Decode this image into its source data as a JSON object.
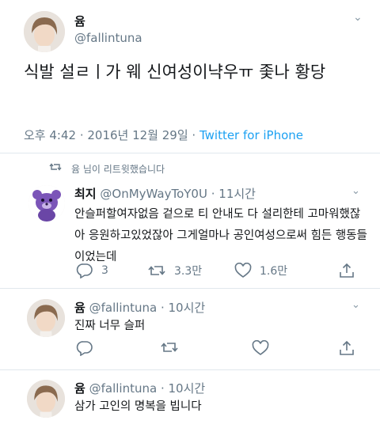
{
  "main_tweet": {
    "display_name": "윰",
    "handle": "@fallintuna",
    "text": "식발 설ㄹㅣ가 웨 신여성이냑우ㅠ 좇나 황당",
    "timestamp": "오후 4:42 · 2016년 12월 29일 · ",
    "source": "Twitter for iPhone"
  },
  "retweet_note": "윰 님이 리트윗했습니다",
  "retweeted": {
    "display_name": "최지",
    "handle": "@OnMyWayToY0U",
    "time": "· 11시간",
    "text": "안슬퍼할여자없음 겉으로 티 안내도 다 설리한테 고마워했잖아 응원하고있었잖아 그게얼마나 공인여성으로써 힘든 행동들이었는데",
    "counts": {
      "reply": "3",
      "retweet": "3.3만",
      "like": "1.6만"
    }
  },
  "replies": [
    {
      "display_name": "윰",
      "handle": "@fallintuna",
      "time": "· 10시간",
      "text": "진짜 너무 슬퍼"
    },
    {
      "display_name": "윰",
      "handle": "@fallintuna",
      "time": "· 10시간",
      "text": "삼가 고인의 명복을 빕니다"
    }
  ],
  "colors": {
    "link": "#1da1f2",
    "muted": "#657786",
    "divider": "#e1e8ed"
  },
  "icons": [
    "chevron-down-icon",
    "retweet-icon",
    "reply-icon",
    "like-icon",
    "share-icon"
  ]
}
